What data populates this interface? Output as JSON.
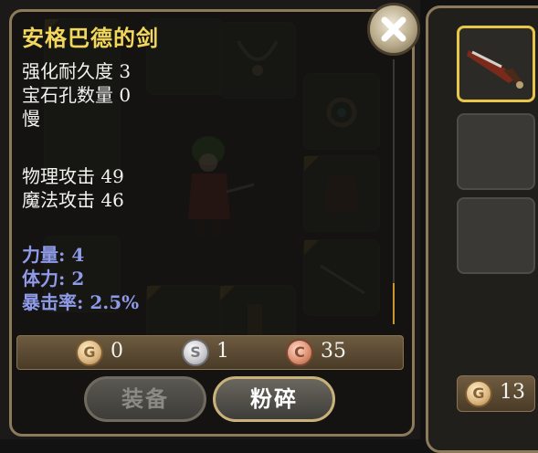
{
  "item": {
    "name": "安格巴德的剑",
    "lines": [
      "强化耐久度 3",
      "宝石孔数量 0",
      "慢"
    ],
    "attack": [
      "物理攻击 49",
      "魔法攻击 46"
    ],
    "bonuses": [
      "力量: 4",
      "体力: 2",
      "暴击率: 2.5%"
    ]
  },
  "price": {
    "gold": "0",
    "silver": "1",
    "copper": "35"
  },
  "coin_letters": {
    "gold": "G",
    "silver": "S",
    "copper": "C"
  },
  "buttons": {
    "equip": "装备",
    "smash": "粉碎"
  },
  "sidebar": {
    "gold_count": "13"
  },
  "icons": [
    "close-icon",
    "sword-icon",
    "gold-coin-icon",
    "silver-coin-icon",
    "copper-coin-icon"
  ],
  "colors": {
    "title": "#f2d75c",
    "bonus": "#8f9ae8",
    "frame": "#8c7a5a",
    "selected_slot": "#e8c64a"
  }
}
